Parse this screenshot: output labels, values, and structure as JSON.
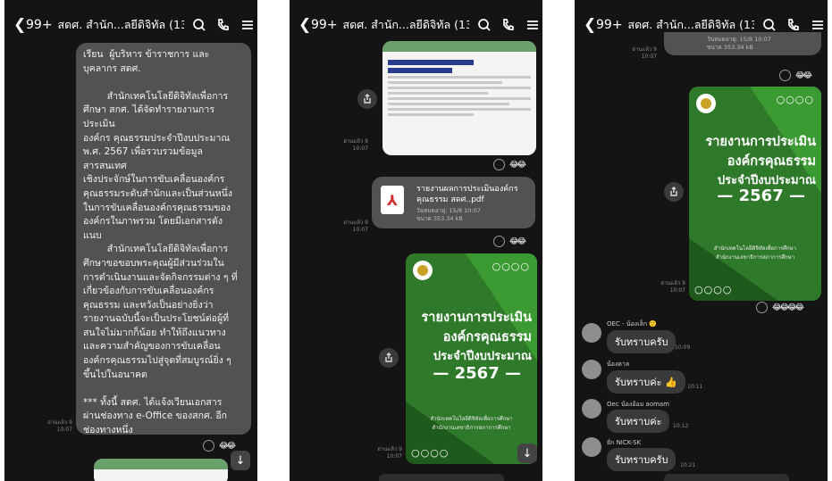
{
  "header": {
    "back": "❮",
    "count": "99+",
    "title": "สดศ. สำนัก...ลยีดิจิทัล (13)"
  },
  "icons": {
    "search": "search-icon",
    "call": "phone-icon",
    "menu": "menu-icon"
  },
  "colors": {
    "background": "#141414",
    "bubble": "#525252",
    "cover_green": "#2f7a2a",
    "reply_bubble": "#3a3a3a"
  },
  "panel1": {
    "message": "เรียน  ผู้บริหาร ข้าราชการ และ\nบุคลากร สดศ.\n\n        สำนักเทคโนโลยีดิจิทัลเพื่อการ\nศึกษา สกศ. ได้จัดทำรายงานการ\nประเมิน\nองค์กร คุณธรรมประจำปีงบประมาณ\nพ.ศ. 2567 เพื่อรวบรวมข้อมูล\nสารสนเทศ\nเชิงประจักษ์ในการขับเคลื่อนองค์กร\nคุณธรรมระดับสำนักและเป็นส่วนหนึ่ง\nในการขับเคลื่อนองค์กรคุณธรรมของ\nองค์กรในภาพรวม โดยมีเอกสารดัง\nแนบ\n        สำนักเทคโนโลยีดิจิทัลเพื่อการ\nศึกษาขอขอบพระคุณผู้มีส่วนร่วมใน\nการดำเนินงานและจัดกิจกรรมต่าง ๆ ที่\nเกี่ยวข้องกับการขับเคลื่อนองค์กร\nคุณธรรม และหวังเป็นอย่างยิ่งว่า\nรายงานฉบับนี้จะเป็นประโยชน์ต่อผู้ที่\nสนใจไม่มากก็น้อย ทำให้ถึงแนวทาง\nและความสำคัญของการขับเคลื่อน\nองค์กรคุณธรรมไปสู่จุดที่สมบูรณ์ยิ่ง ๆ\nขึ้นไปในอนาคต\n\n*** ทั้งนี้ สดศ. ได้แจ้งเวียนเอกสาร\nผ่านช่องทาง e-Office ของสกศ. อีก\nช่องทางหนึ่ง",
    "read": "อ่านแล้ว 9",
    "time": "10:07",
    "reactions": "😂😂"
  },
  "panel2": {
    "read_doc": "อ่านแล้ว 9",
    "time_doc": "10:07",
    "reactions_doc": "😂😂",
    "pdf_name": "รายงานผลการประเมินองค์กรคุณธรรม สดศ..pdf",
    "pdf_expiry": "วันหมดอายุ: 15/8 10:07",
    "pdf_size": "ขนาด 353.34 kB",
    "read_pdf": "อ่านแล้ว 9",
    "time_pdf": "10:07",
    "reactions_pdf": "😂😂",
    "read_cover": "อ่านแล้ว 9",
    "time_cover": "10:07"
  },
  "cover": {
    "dots": "○○○○",
    "line1": "รายงานการประเมิน",
    "line2": "องค์กรคุณธรรม",
    "line3": "ประจำปีงบประมาณ",
    "line4": "— 2567 —",
    "sub1": "สำนักเทคโนโลยีดิจิทัลเพื่อการศึกษา",
    "sub2": "สำนักงานเลขาธิการสภาการศึกษา"
  },
  "panel3": {
    "pdf_expiry": "วันหมดอายุ: 15/8 10:07",
    "pdf_size": "ขนาด 353.34 kB",
    "read_top": "อ่านแล้ว 9",
    "time_top": "10:07",
    "reactions_top": "😂😂",
    "read_cover": "อ่านแล้ว 9",
    "time_cover": "10:07",
    "reactions_cover": "😂😂😂😂",
    "replies": [
      {
        "sender": "OEC - น้องเล็ก 🙂",
        "text": "รับทราบครับ",
        "time": "10:09"
      },
      {
        "sender": "น้องตาล",
        "text": "รับทราบค่ะ 👍",
        "time": "10:11"
      },
      {
        "sender": "Oec น้องอ้อม aomam",
        "text": "รับทราบค่ะ",
        "time": "10:12"
      },
      {
        "sender": "ยัก NICK-SK",
        "text": "รับทราบครับ",
        "time": "10:21"
      }
    ]
  }
}
